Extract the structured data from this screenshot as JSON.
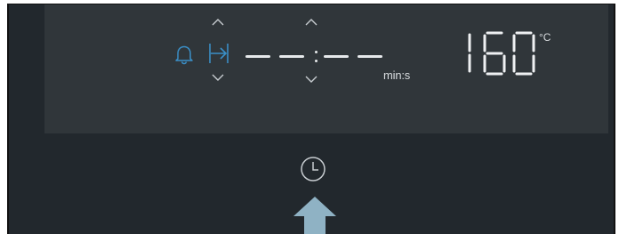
{
  "display": {
    "timer_value": "--:--",
    "timer_unit": "min:s",
    "temperature_value": "160",
    "temperature_unit": "°C"
  },
  "icons": {
    "alarm": "bell-icon",
    "duration": "duration-end-icon",
    "clock": "clock-icon",
    "up": "chevron-up-icon",
    "down": "chevron-down-icon",
    "pointer": "arrow-up-icon"
  },
  "colors": {
    "panel_background": "#30363a",
    "frame_background": "#22282d",
    "active_icon": "#3a8fc7",
    "segment": "#eef0f2",
    "pointer_arrow": "#8fb2c4"
  }
}
